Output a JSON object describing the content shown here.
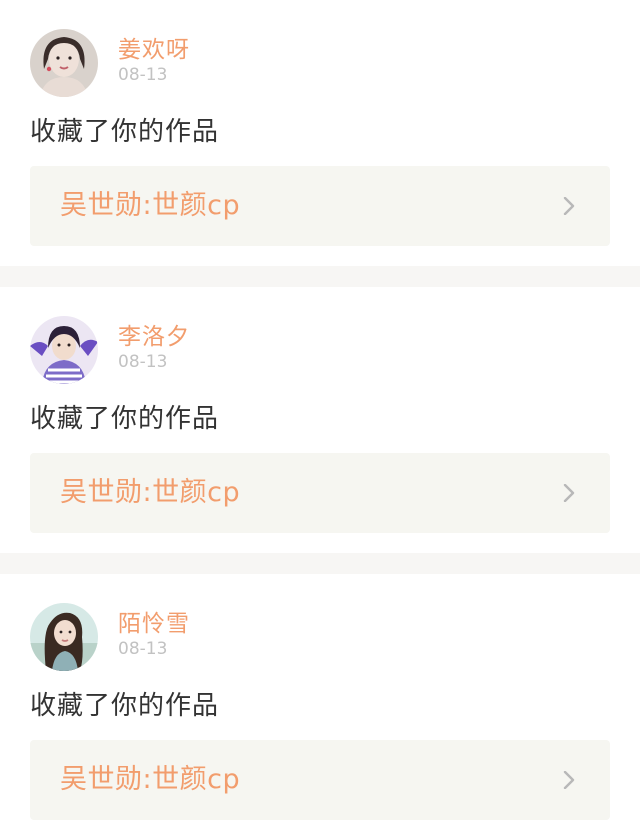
{
  "notifications": [
    {
      "username": "姜欢呀",
      "date": "08-13",
      "action": "收藏了你的作品",
      "work_title": "吴世勋:世颜cp",
      "avatar_icon": "user-avatar-1"
    },
    {
      "username": "李洛夕",
      "date": "08-13",
      "action": "收藏了你的作品",
      "work_title": "吴世勋:世颜cp",
      "avatar_icon": "user-avatar-2"
    },
    {
      "username": "陌怜雪",
      "date": "08-13",
      "action": "收藏了你的作品",
      "work_title": "吴世勋:世颜cp",
      "avatar_icon": "user-avatar-3"
    }
  ],
  "colors": {
    "accent": "#f29d6d",
    "date": "#c2c2c2",
    "text": "#333333",
    "card_bg": "#f6f6f1",
    "divider": "#f7f6f4"
  }
}
